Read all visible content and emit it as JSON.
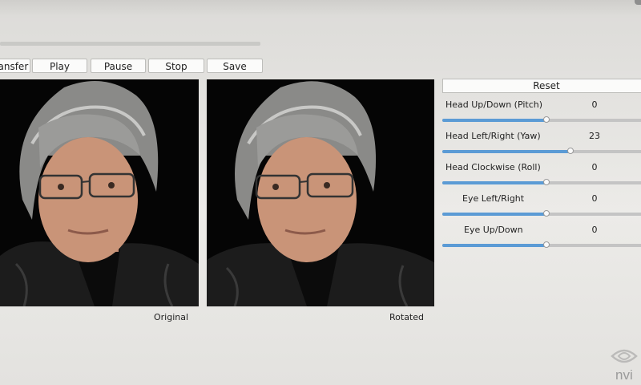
{
  "toolbar": {
    "transfer_label": "Transfer",
    "play_label": "Play",
    "pause_label": "Pause",
    "stop_label": "Stop",
    "save_label": "Save"
  },
  "playback": {
    "progress": 0
  },
  "images": {
    "original_caption": "Original",
    "rotated_caption": "Rotated"
  },
  "controls": {
    "reset_label": "Reset",
    "range": [
      -100,
      100
    ],
    "items": [
      {
        "label": "Head Up/Down (Pitch)",
        "value": "0",
        "level": 0
      },
      {
        "label": "Head Left/Right (Yaw)",
        "value": "23",
        "level": 23
      },
      {
        "label": "Head Clockwise (Roll)",
        "value": "0",
        "level": 0
      },
      {
        "label": "Eye Left/Right",
        "value": "0",
        "level": 0
      },
      {
        "label": "Eye Up/Down",
        "value": "0",
        "level": 0
      }
    ]
  },
  "watermark": {
    "text": "nvi",
    "icon": "nvidia-eye-logo"
  },
  "colors": {
    "accent": "#5b9bd5",
    "image_bg": "#050505"
  }
}
